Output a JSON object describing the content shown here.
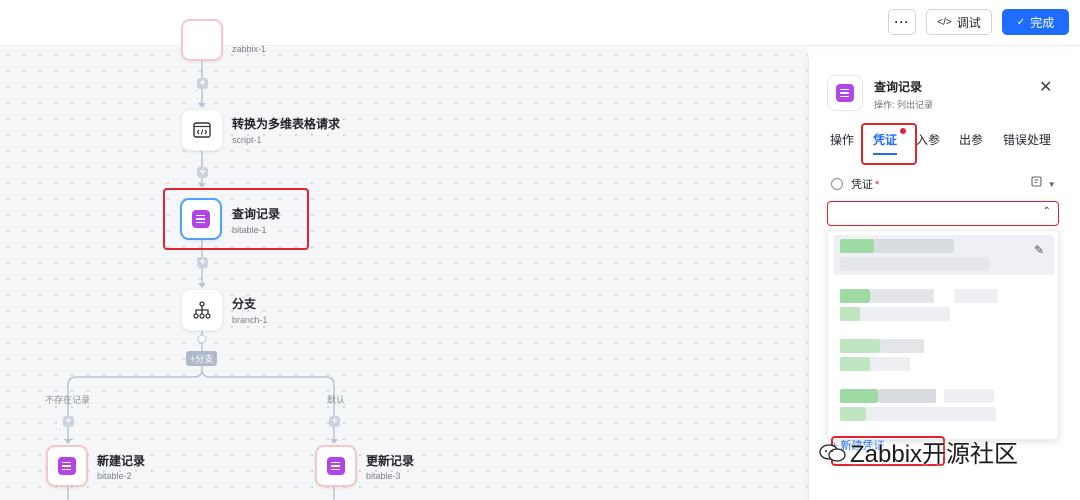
{
  "toolbar": {
    "more_label": "···",
    "debug_icon": "</>",
    "debug_label": "调试",
    "done_icon": "✓",
    "done_label": "完成"
  },
  "flow": {
    "top_node_sub": "zabbix-1",
    "nodes": [
      {
        "title": "转换为多维表格请求",
        "sub": "script-1",
        "icon": "code-icon"
      },
      {
        "title": "查询记录",
        "sub": "bitable-1",
        "icon": "bitable-icon"
      },
      {
        "title": "分支",
        "sub": "branch-1",
        "icon": "branch-icon"
      },
      {
        "title": "新建记录",
        "sub": "bitable-2",
        "icon": "bitable-icon"
      },
      {
        "title": "更新记录",
        "sub": "bitable-3",
        "icon": "bitable-icon"
      }
    ],
    "branch_tag": "+分支",
    "branch_left_label": "不存在记录",
    "branch_right_label": "默认"
  },
  "panel": {
    "title": "查询记录",
    "subtitle": "操作: 列出记录",
    "close": "✕",
    "tabs": [
      "操作",
      "凭证",
      "入参",
      "出参",
      "错误处理"
    ],
    "active_tab": "凭证",
    "field_label": "凭证",
    "required_mark": "*",
    "select_arrow": "⌃",
    "dropdown_edit_icon": "✎",
    "new_button": "+ 新建凭证"
  },
  "watermark": "Zabbix开源社区",
  "colors": {
    "accent": "#1f6cff",
    "highlight_red": "#e0242e",
    "bitable_purple": "#b344e8"
  }
}
